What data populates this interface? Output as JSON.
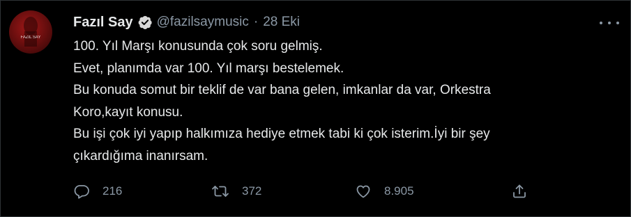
{
  "tweet": {
    "display_name": "Fazıl Say",
    "handle": "@fazilsaymusic",
    "separator": "·",
    "time": "28 Eki",
    "text_lines": [
      "100. Yıl Marşı konusunda çok soru gelmiş.",
      "Evet, planımda var 100. Yıl marşı bestelemek.",
      "Bu konuda somut bir teklif de var bana gelen, imkanlar da var, Orkestra",
      "Koro,kayıt konusu.",
      "Bu işi çok iyi yapıp halkımıza hediye etmek tabi ki çok isterim.İyi bir şey",
      "çıkardığıma inanırsam."
    ],
    "avatar_text": "FAZIL SAY"
  },
  "actions": {
    "replies": "216",
    "retweets": "372",
    "likes": "8.905"
  },
  "icons": {
    "verified": "verified-badge-icon",
    "more": "more-dots-icon",
    "reply": "reply-icon",
    "retweet": "retweet-icon",
    "like": "heart-icon",
    "share": "share-icon"
  },
  "colors": {
    "background": "#000000",
    "text": "#e7e9ea",
    "secondary": "#8b98a5",
    "border": "#2f3336",
    "verified_badge": "#d9d9d9"
  }
}
